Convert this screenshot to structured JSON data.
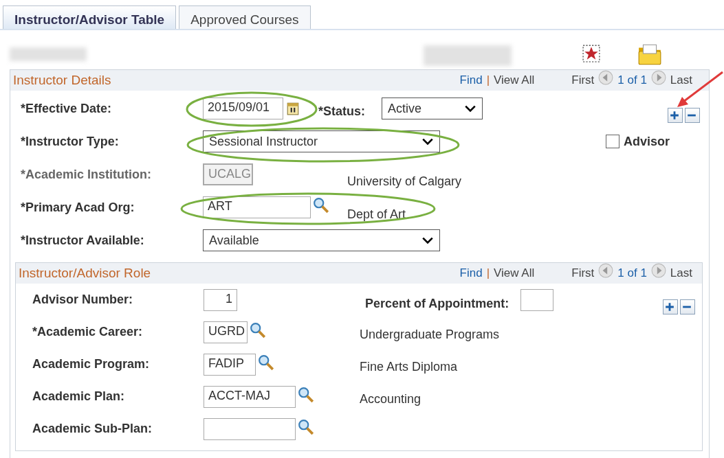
{
  "tabs": [
    {
      "label": "Instructor/Advisor Table",
      "selected": true
    },
    {
      "label": "Approved Courses",
      "selected": false
    }
  ],
  "details": {
    "title": "Instructor Details",
    "nav": {
      "find": "Find",
      "separator": "|",
      "view_all": "View All",
      "first": "First",
      "count": "1 of 1",
      "last": "Last"
    },
    "effective_date": {
      "label": "*Effective Date:",
      "value": "2015/09/01"
    },
    "status": {
      "label": "*Status:",
      "value": "Active"
    },
    "instructor_type": {
      "label": "*Instructor Type:",
      "value": "Sessional Instructor"
    },
    "advisor": {
      "label": "Advisor",
      "checked": false
    },
    "institution": {
      "label": "*Academic Institution:",
      "value": "UCALG",
      "description": "University of Calgary",
      "disabled": true
    },
    "acad_org": {
      "label": "*Primary Acad Org:",
      "value": "ART",
      "description": "Dept of Art"
    },
    "available": {
      "label": "*Instructor Available:",
      "value": "Available"
    }
  },
  "role": {
    "title": "Instructor/Advisor Role",
    "nav": {
      "find": "Find",
      "separator": "|",
      "view_all": "View All",
      "first": "First",
      "count": "1 of 1",
      "last": "Last"
    },
    "advisor_number": {
      "label": "Advisor Number:",
      "value": "1"
    },
    "percent": {
      "label": "Percent of Appointment:"
    },
    "rows": [
      {
        "label": "*Academic Career:",
        "value": "UGRD",
        "description": "Undergraduate Programs"
      },
      {
        "label": "Academic Program:",
        "value": "FADIP",
        "description": "Fine Arts Diploma"
      },
      {
        "label": "Academic Plan:",
        "value": "ACCT-MAJ",
        "description": "Accounting"
      },
      {
        "label": "Academic Sub-Plan:"
      }
    ]
  }
}
